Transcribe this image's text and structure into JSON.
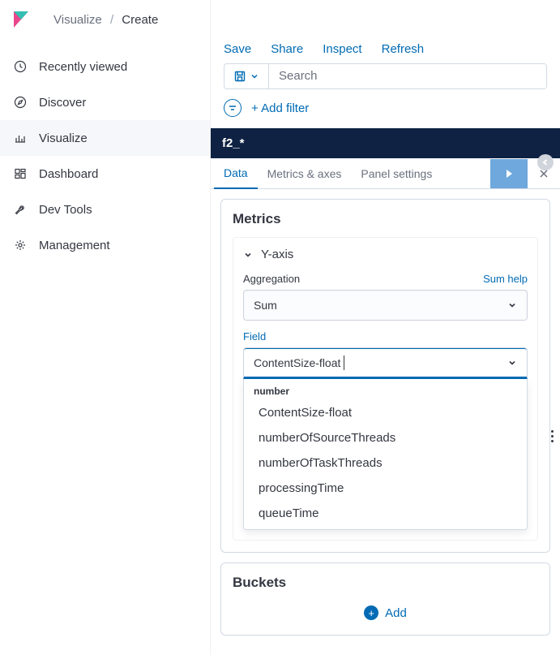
{
  "breadcrumb": {
    "parent": "Visualize",
    "current": "Create"
  },
  "nav": {
    "items": [
      {
        "label": "Recently viewed"
      },
      {
        "label": "Discover"
      },
      {
        "label": "Visualize"
      },
      {
        "label": "Dashboard"
      },
      {
        "label": "Dev Tools"
      },
      {
        "label": "Management"
      }
    ]
  },
  "toolbar": {
    "save": "Save",
    "share": "Share",
    "inspect": "Inspect",
    "refresh": "Refresh"
  },
  "search": {
    "placeholder": "Search"
  },
  "filter": {
    "add_label": "+ Add filter"
  },
  "index_pattern": "f2_*",
  "tabs": {
    "data": "Data",
    "metrics_axes": "Metrics & axes",
    "panel_settings": "Panel settings"
  },
  "metrics": {
    "title": "Metrics",
    "yaxis_label": "Y-axis",
    "aggregation_label": "Aggregation",
    "aggregation_help": "Sum help",
    "aggregation_value": "Sum",
    "field_label": "Field",
    "field_value": "ContentSize-float",
    "field_group": "number",
    "field_options": [
      "ContentSize-float",
      "numberOfSourceThreads",
      "numberOfTaskThreads",
      "processingTime",
      "queueTime"
    ]
  },
  "buckets": {
    "title": "Buckets",
    "add_label": "Add"
  }
}
